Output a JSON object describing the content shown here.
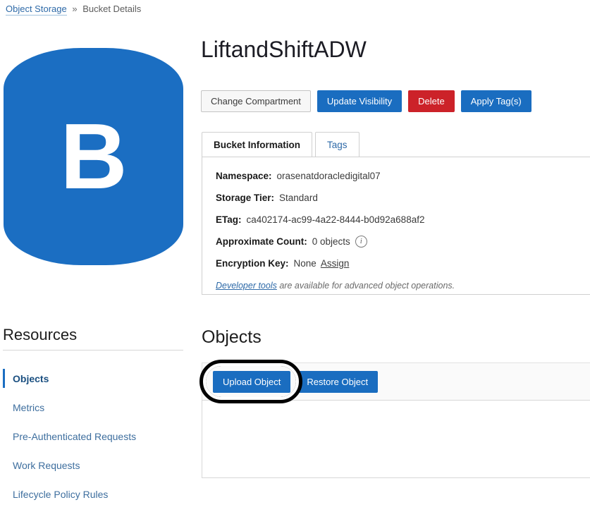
{
  "breadcrumb": {
    "root": "Object Storage",
    "separator": "»",
    "current": "Bucket Details"
  },
  "bucket_icon": {
    "letter": "B",
    "color": "#1b6ec2"
  },
  "header": {
    "title": "LiftandShiftADW"
  },
  "actions": {
    "change_compartment": "Change Compartment",
    "update_visibility": "Update Visibility",
    "delete": "Delete",
    "apply_tags": "Apply Tag(s)"
  },
  "tabs": [
    {
      "label": "Bucket Information",
      "active": true
    },
    {
      "label": "Tags",
      "active": false
    }
  ],
  "bucket_information": {
    "namespace_label": "Namespace:",
    "namespace_value": "orasenatdoracledigital07",
    "storage_tier_label": "Storage Tier:",
    "storage_tier_value": "Standard",
    "etag_label": "ETag:",
    "etag_value": "ca402174-ac99-4a22-8444-b0d92a688af2",
    "approximate_count_label": "Approximate Count:",
    "approximate_count_value": "0 objects",
    "approximate_count_info_icon": "info-icon",
    "encryption_key_label": "Encryption Key:",
    "encryption_key_value": "None",
    "encryption_key_assign": "Assign",
    "developer_tools_link": "Developer tools",
    "developer_tools_note": "are available for advanced object operations."
  },
  "resources": {
    "heading": "Resources",
    "items": [
      {
        "label": "Objects",
        "active": true
      },
      {
        "label": "Metrics",
        "active": false
      },
      {
        "label": "Pre-Authenticated Requests",
        "active": false
      },
      {
        "label": "Work Requests",
        "active": false
      },
      {
        "label": "Lifecycle Policy Rules",
        "active": false
      }
    ]
  },
  "objects_section": {
    "heading": "Objects",
    "upload_object": "Upload Object",
    "restore_object": "Restore Object"
  },
  "colors": {
    "primary_blue": "#1a6dc0",
    "danger_red": "#cc2229",
    "link_blue": "#2e6aa8",
    "highlight_ring": "#000000"
  }
}
